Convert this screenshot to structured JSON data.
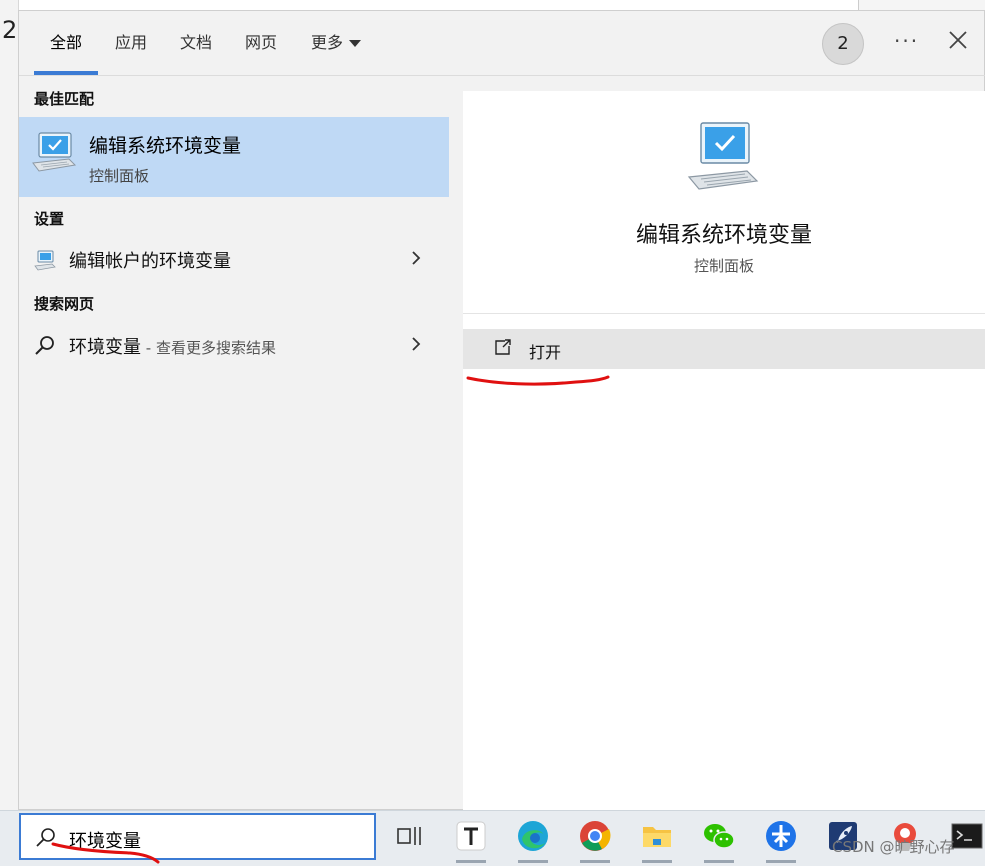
{
  "background": {
    "left_char": "2"
  },
  "header": {
    "tabs": [
      {
        "label": "全部",
        "active": true
      },
      {
        "label": "应用"
      },
      {
        "label": "文档"
      },
      {
        "label": "网页"
      },
      {
        "label": "更多"
      }
    ],
    "badge": "2",
    "more_label": "···"
  },
  "results": {
    "best_match_label": "最佳匹配",
    "best_match": {
      "title": "编辑系统环境变量",
      "subtitle": "控制面板",
      "icon": "monitor-check-icon"
    },
    "settings_label": "设置",
    "settings_items": [
      {
        "label": "编辑帐户的环境变量",
        "icon": "monitor-icon"
      }
    ],
    "web_label": "搜索网页",
    "web_items": [
      {
        "label": "环境变量",
        "hint": " - 查看更多搜索结果",
        "icon": "search-icon"
      }
    ]
  },
  "detail": {
    "title": "编辑系统环境变量",
    "subtitle": "控制面板",
    "open_label": "打开",
    "icon": "monitor-check-icon"
  },
  "search": {
    "value": "环境变量"
  },
  "taskbar": {
    "icons": [
      "task-view-icon",
      "typora-icon",
      "edge-icon",
      "chrome-icon",
      "file-explorer-icon",
      "wechat-icon",
      "feishu-icon",
      "rocket-app-icon",
      "tool-app-icon",
      "terminal-icon"
    ]
  },
  "watermark": "CSDN @旷野心存",
  "colors": {
    "accent": "#3b7bd4",
    "selected": "#bfd9f5",
    "annotation": "#e01010"
  }
}
